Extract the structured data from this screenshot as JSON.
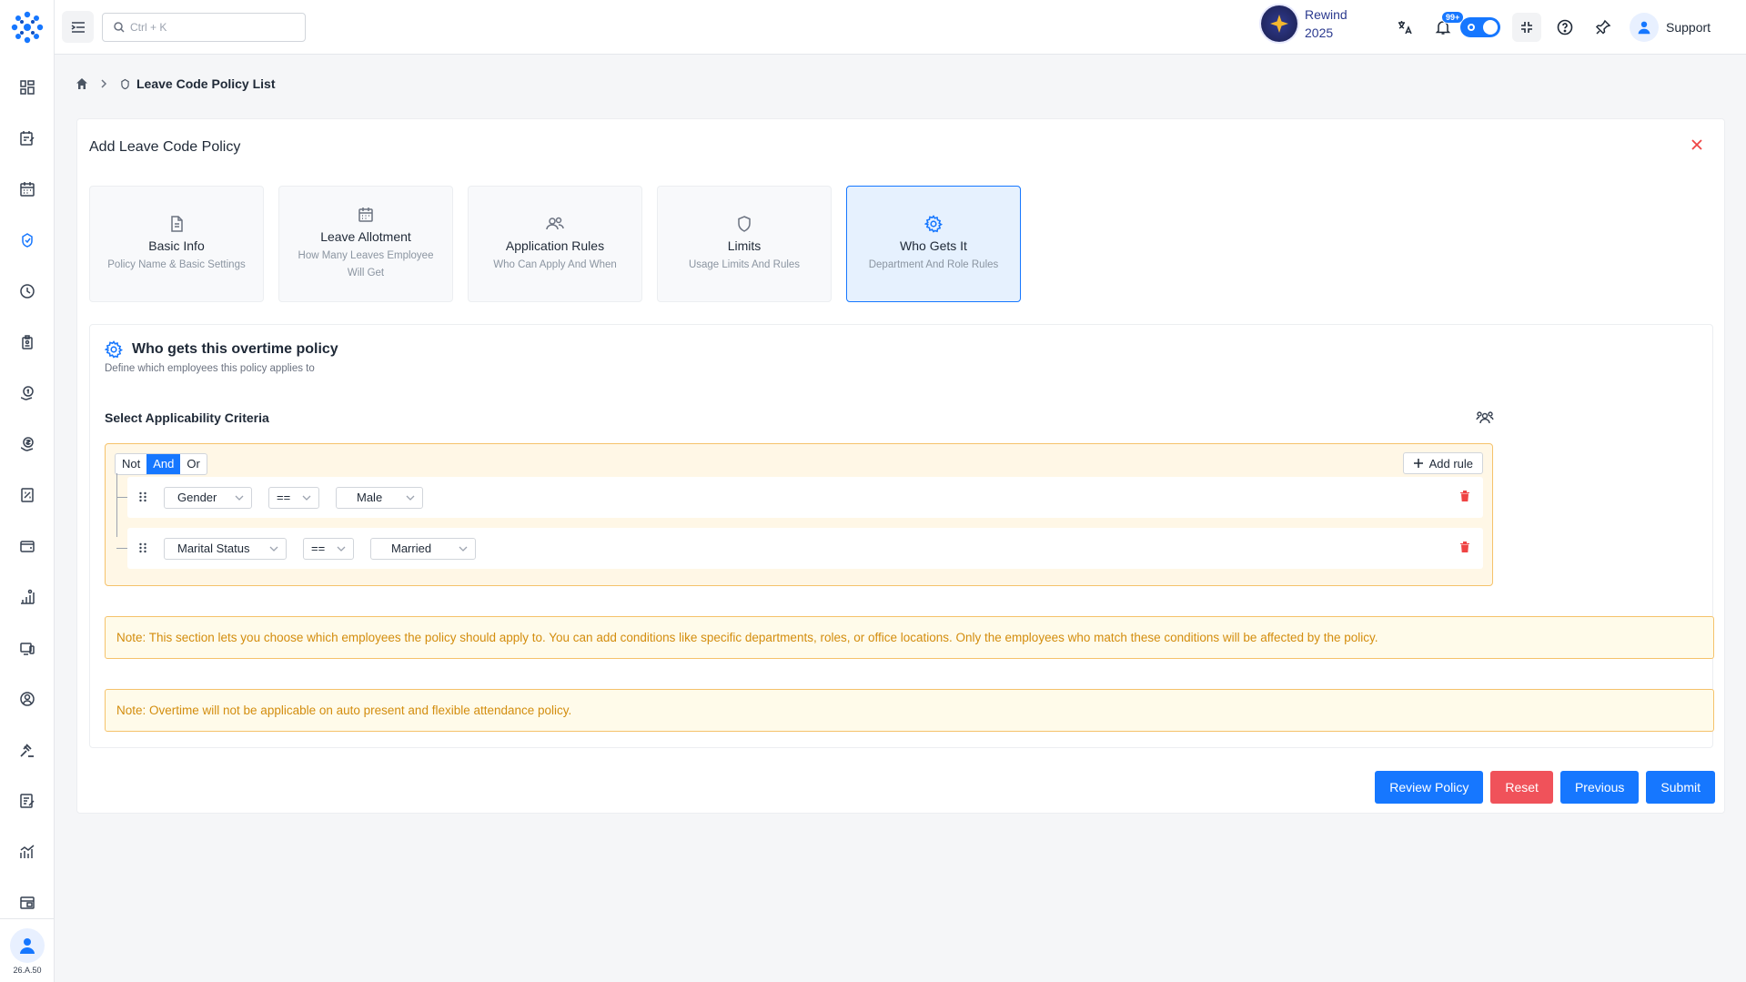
{
  "header": {
    "search_placeholder": "Ctrl + K",
    "rewind_line1": "Rewind",
    "rewind_line2": "2025",
    "notification_badge": "99+",
    "support_label": "Support"
  },
  "sidebar": {
    "version": "26.A.50",
    "items": [
      {
        "icon": "dashboard-icon"
      },
      {
        "icon": "leave-request-icon"
      },
      {
        "icon": "calendar-icon"
      },
      {
        "icon": "leave-policy-icon",
        "active": true
      },
      {
        "icon": "attendance-clock-icon"
      },
      {
        "icon": "badge-icon"
      },
      {
        "icon": "payroll-icon"
      },
      {
        "icon": "salary-icon"
      },
      {
        "icon": "expense-icon"
      },
      {
        "icon": "wallet-icon"
      },
      {
        "icon": "performance-icon"
      },
      {
        "icon": "assets-icon"
      },
      {
        "icon": "profile-icon"
      },
      {
        "icon": "legal-icon"
      },
      {
        "icon": "tasks-icon"
      },
      {
        "icon": "analytics-icon"
      },
      {
        "icon": "admin-icon"
      }
    ]
  },
  "breadcrumb": {
    "current": "Leave Code Policy List"
  },
  "card": {
    "title": "Add Leave Code Policy",
    "steps": [
      {
        "title": "Basic Info",
        "subtitle": "Policy Name & Basic Settings",
        "icon": "document-icon"
      },
      {
        "title": "Leave Allotment",
        "subtitle": "How Many Leaves Employee Will Get",
        "icon": "calendar-icon"
      },
      {
        "title": "Application Rules",
        "subtitle": "Who Can Apply And When",
        "icon": "users-icon"
      },
      {
        "title": "Limits",
        "subtitle": "Usage Limits And Rules",
        "icon": "shield-icon"
      },
      {
        "title": "Who Gets It",
        "subtitle": "Department And Role Rules",
        "icon": "gear-icon",
        "active": true
      }
    ]
  },
  "panel": {
    "title": "Who gets this overtime policy",
    "subtitle": "Define which employees this policy applies to",
    "criteria_label": "Select Applicability Criteria"
  },
  "query": {
    "combinators": [
      "Not",
      "And",
      "Or"
    ],
    "active_combinator": "And",
    "add_rule_label": "Add rule",
    "rules": [
      {
        "field": "Gender",
        "operator": "==",
        "value": "Male"
      },
      {
        "field": "Marital Status",
        "operator": "==",
        "value": "Married"
      }
    ]
  },
  "notes": {
    "note1": "Note: This section lets you choose which employees the policy should apply to. You can add conditions like specific departments, roles, or office locations. Only the employees who match these conditions will be affected by the policy.",
    "note2": "Note: Overtime will not be applicable on auto present and flexible attendance policy."
  },
  "actions": {
    "review": "Review Policy",
    "reset": "Reset",
    "previous": "Previous",
    "submit": "Submit"
  },
  "colors": {
    "primary": "#1677ff",
    "danger": "#f0525a",
    "warning_text": "#d38d0e",
    "warning_border": "#f5c26b"
  }
}
